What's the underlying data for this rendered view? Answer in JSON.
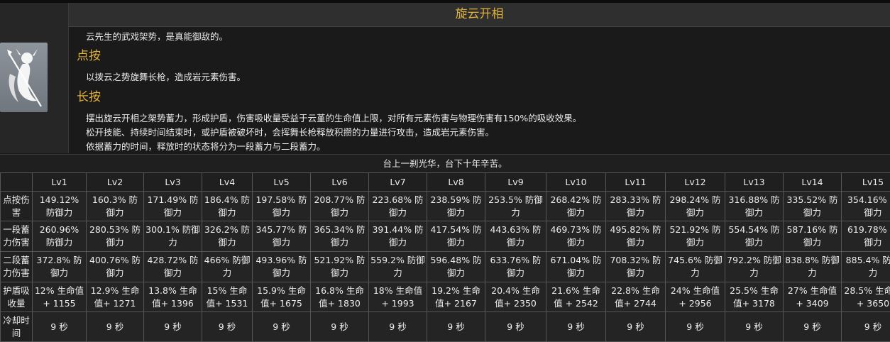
{
  "skill": {
    "title": "旋云开相",
    "intro": "云先生的武戏架势，是真能御敌的。",
    "tap": {
      "heading": "点按",
      "text": "以拨云之势旋舞长枪，造成岩元素伤害。"
    },
    "hold": {
      "heading": "长按",
      "lines": [
        "摆出旋云开相之架势蓄力，形成护盾，伤害吸收量受益于云堇的生命值上限，对所有元素伤害与物理伤害有150%的吸收效果。",
        "松开技能、持续时间结束时，或护盾被破坏时，会挥舞长枪释放积攒的力量进行攻击，造成岩元素伤害。",
        "依据蓄力的时间，释放时的状态将分为一段蓄力与二段蓄力。"
      ]
    },
    "quote": "台上一刹光华，台下十年辛苦。",
    "icon": "yunjin-spear-icon"
  },
  "table": {
    "levels": [
      "Lv1",
      "Lv2",
      "Lv3",
      "Lv4",
      "Lv5",
      "Lv6",
      "Lv7",
      "Lv8",
      "Lv9",
      "Lv10",
      "Lv11",
      "Lv12",
      "Lv13",
      "Lv14",
      "Lv15"
    ],
    "rows": [
      {
        "label": "点按伤害",
        "values": [
          "149.12% 防御力",
          "160.3% 防御力",
          "171.49% 防御力",
          "186.4% 防御力",
          "197.58% 防御力",
          "208.77% 防御力",
          "223.68% 防御力",
          "238.59% 防御力",
          "253.5% 防御力",
          "268.42% 防御力",
          "283.33% 防御力",
          "298.24% 防御力",
          "316.88% 防御力",
          "335.52% 防御力",
          "354.16% 防御力"
        ]
      },
      {
        "label": "一段蓄力伤害",
        "values": [
          "260.96% 防御力",
          "280.53% 防御力",
          "300.1% 防御力",
          "326.2% 防御力",
          "345.77% 防御力",
          "365.34% 防御力",
          "391.44% 防御力",
          "417.54% 防御力",
          "443.63% 防御力",
          "469.73% 防御力",
          "495.82% 防御力",
          "521.92% 防御力",
          "554.54% 防御力",
          "587.16% 防御力",
          "619.78% 防御力"
        ]
      },
      {
        "label": "二段蓄力伤害",
        "values": [
          "372.8% 防御力",
          "400.76% 防御力",
          "428.72% 防御力",
          "466% 防御力",
          "493.96% 防御力",
          "521.92% 防御力",
          "559.2% 防御力",
          "596.48% 防御力",
          "633.76% 防御力",
          "671.04% 防御力",
          "708.32% 防御力",
          "745.6% 防御力",
          "792.2% 防御力",
          "838.8% 防御力",
          "885.4% 防御力"
        ]
      },
      {
        "label": "护盾吸收量",
        "values": [
          "12% 生命值+ 1155",
          "12.9% 生命值+ 1271",
          "13.8% 生命值+ 1396",
          "15% 生命值+ 1531",
          "15.9% 生命值+ 1675",
          "16.8% 生命值+ 1830",
          "18% 生命值 + 1993",
          "19.2% 生命值+ 2167",
          "20.4% 生命值+ 2350",
          "21.6% 生命值 + 2542",
          "22.8% 生命值+ 2744",
          "24% 生命值 + 2956",
          "25.5% 生命值+ 3178",
          "27% 生命值 + 3409",
          "28.5% 生命值 + 3650"
        ]
      },
      {
        "label": "冷却时间",
        "values": [
          "9 秒",
          "9 秒",
          "9 秒",
          "9 秒",
          "9 秒",
          "9 秒",
          "9 秒",
          "9 秒",
          "9 秒",
          "9 秒",
          "9 秒",
          "9 秒",
          "9 秒",
          "9 秒",
          "9 秒"
        ]
      }
    ]
  }
}
